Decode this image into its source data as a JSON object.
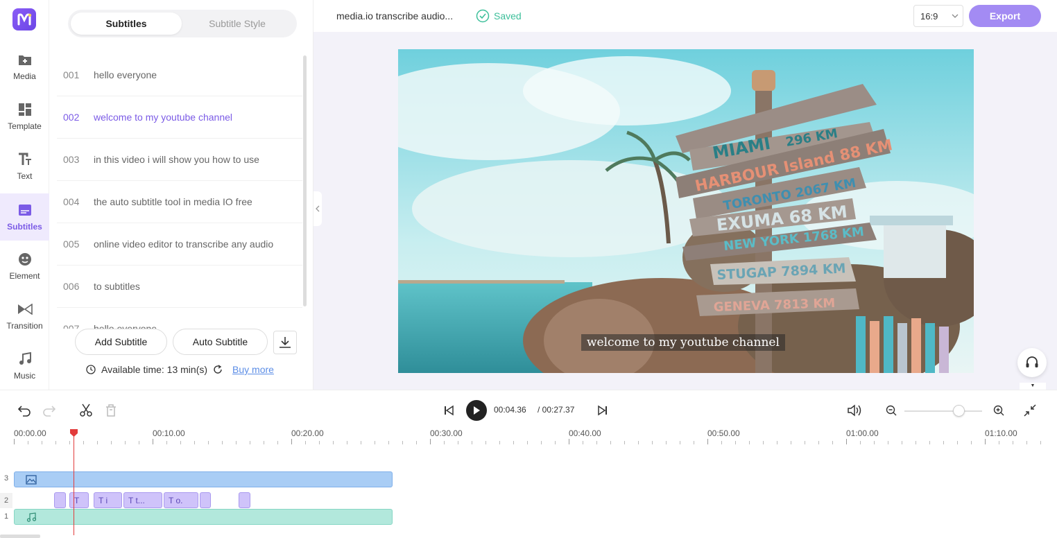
{
  "rail": {
    "items": [
      {
        "label": "Media",
        "icon": "media-add-icon"
      },
      {
        "label": "Template",
        "icon": "template-grid-icon"
      },
      {
        "label": "Text",
        "icon": "text-icon"
      },
      {
        "label": "Subtitles",
        "icon": "subtitles-icon"
      },
      {
        "label": "Element",
        "icon": "element-icon"
      },
      {
        "label": "Transition",
        "icon": "transition-icon"
      },
      {
        "label": "Music",
        "icon": "music-note-icon"
      }
    ],
    "active": "Subtitles"
  },
  "panel": {
    "tabs": {
      "subtitles": "Subtitles",
      "style": "Subtitle Style"
    },
    "subtitles": [
      {
        "num": "001",
        "text": "hello everyone"
      },
      {
        "num": "002",
        "text": "welcome to my youtube channel"
      },
      {
        "num": "003",
        "text": "in this video i will show you how to use"
      },
      {
        "num": "004",
        "text": "the auto subtitle tool in media IO free"
      },
      {
        "num": "005",
        "text": "online video editor to transcribe any audio"
      },
      {
        "num": "006",
        "text": "to subtitles"
      },
      {
        "num": "007",
        "text": "hello everyone"
      }
    ],
    "active_index": 1,
    "add_subtitle": "Add Subtitle",
    "auto_subtitle": "Auto Subtitle",
    "available_time": "Available time: 13 min(s)",
    "buy_more": "Buy more"
  },
  "header": {
    "project_title": "media.io transcribe audio...",
    "saved": "Saved",
    "aspect_ratio": "16:9",
    "export": "Export"
  },
  "preview": {
    "caption": "welcome to my youtube channel",
    "signs": [
      "MIAMI 296 KM",
      "HARBOUR Island 88 KM",
      "TORONTO 2067 KM",
      "EXUMA 68 KM",
      "NEW YORK 1768 KM",
      "STUGAP 7894 KM",
      "GENEVA 7813 KM"
    ]
  },
  "controls": {
    "current_time": "00:04.36",
    "total_time": "/ 00:27.37",
    "zoom_level": 0.63
  },
  "timeline": {
    "ruler": [
      "00:00.00",
      "00:10.00",
      "00:20.00",
      "00:30.00",
      "00:40.00",
      "00:50.00",
      "01:00.00",
      "01:10.00"
    ],
    "tracks": [
      "3",
      "2",
      "1"
    ],
    "text_clips": [
      "",
      "T",
      "T i",
      "T t...",
      "T o.",
      "",
      ""
    ]
  },
  "colors": {
    "accent": "#7b5be6",
    "export_button": "#a38bf3",
    "saved_green": "#3cbf9a",
    "playhead": "#e23b3b",
    "image_track": "#a9cdf5",
    "text_track": "#cfc3fa",
    "audio_track": "#b2e8dc"
  }
}
